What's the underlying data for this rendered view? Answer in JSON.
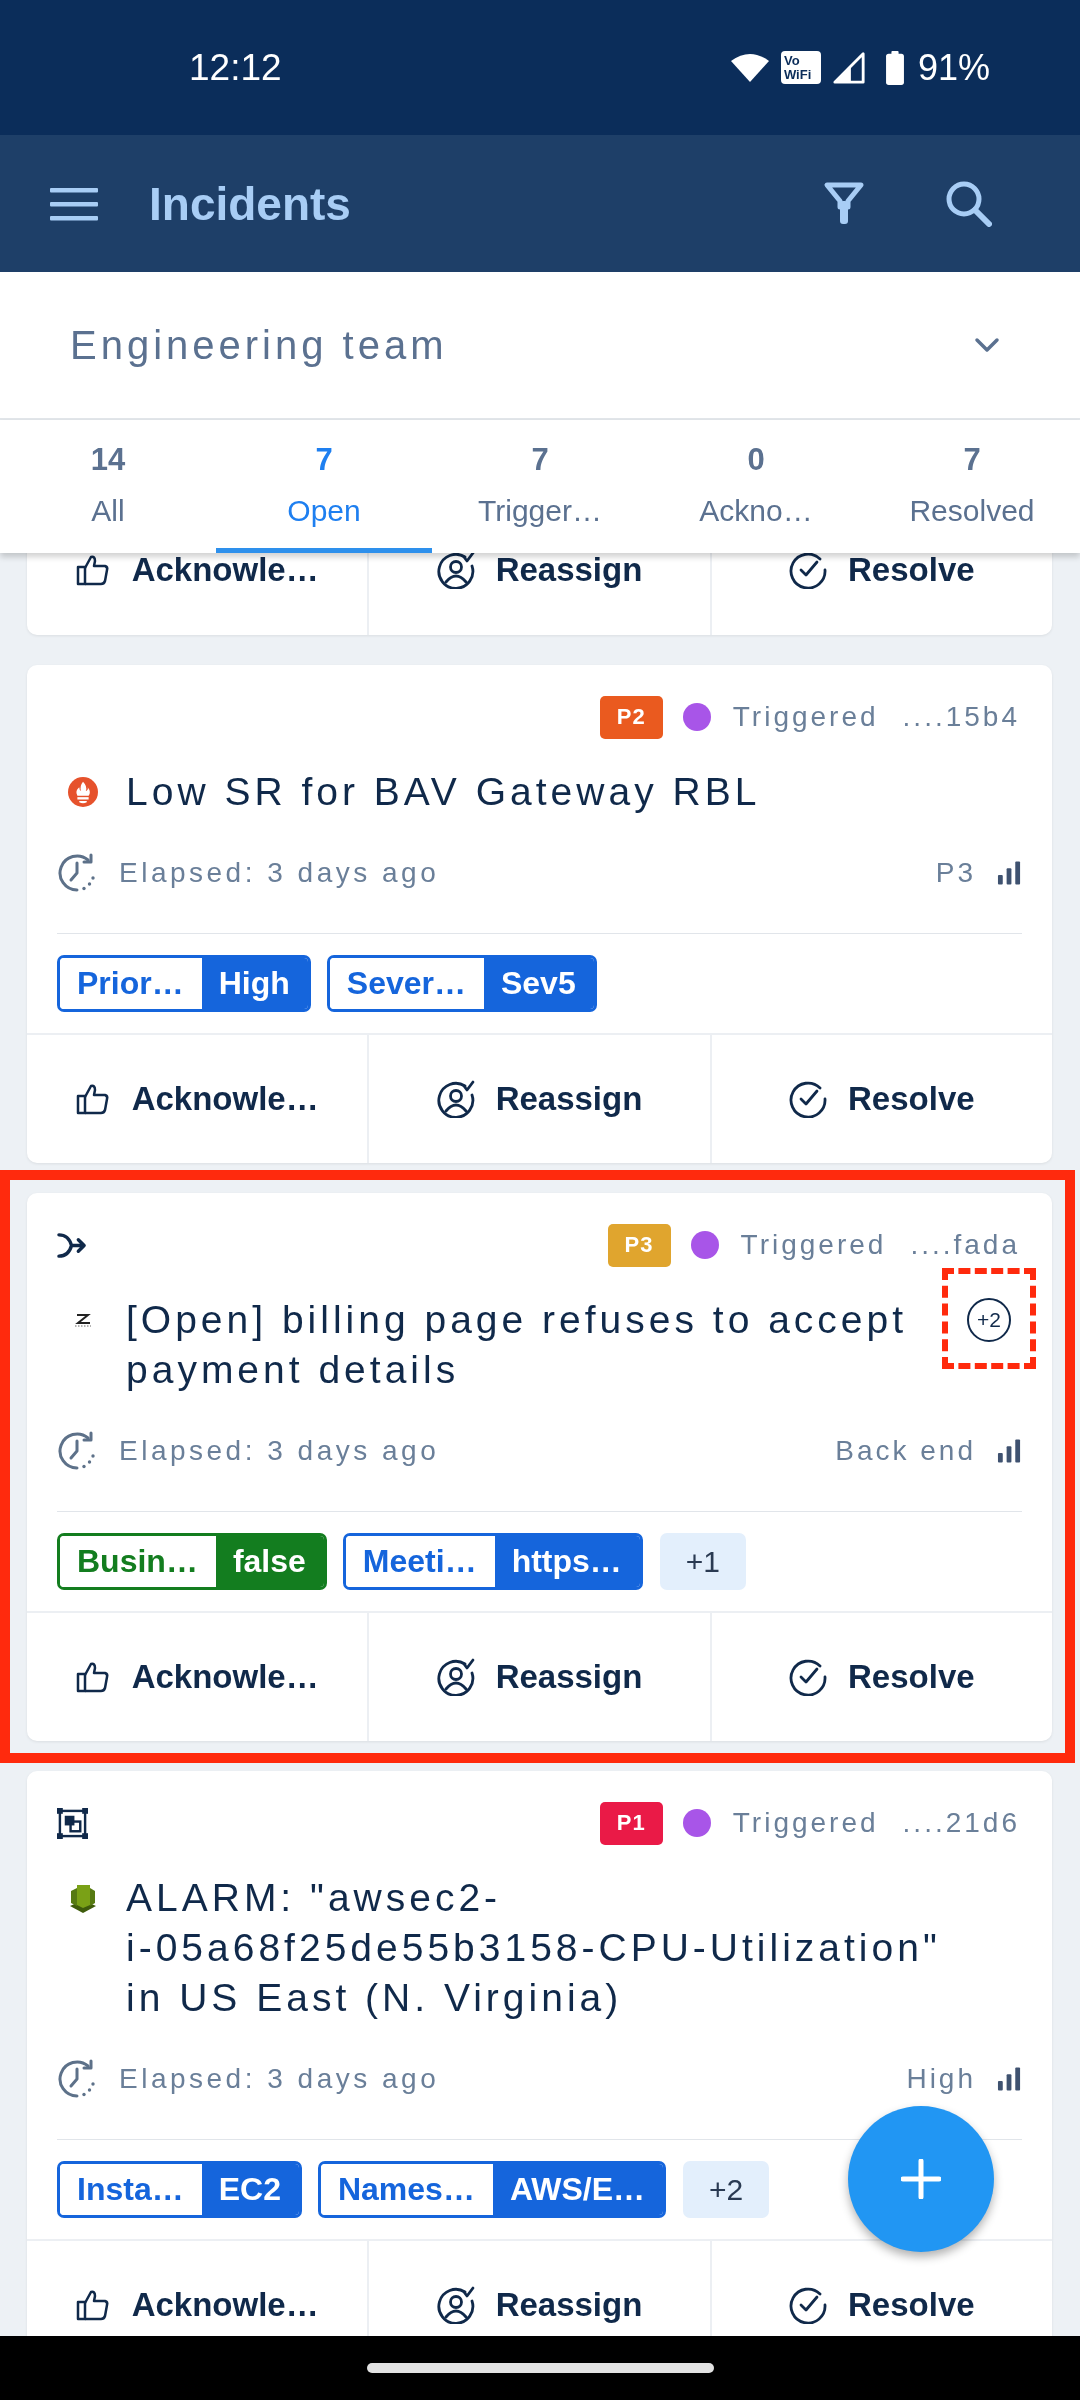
{
  "status_bar": {
    "time": "12:12",
    "vowifi_badge": [
      "Vo",
      "WiFi"
    ],
    "battery": "91%"
  },
  "app_bar": {
    "title": "Incidents"
  },
  "team_selector": {
    "value": "Engineering team"
  },
  "tabs": [
    {
      "count": "14",
      "label": "All",
      "selected": false
    },
    {
      "count": "7",
      "label": "Open",
      "selected": true
    },
    {
      "count": "7",
      "label": "Trigger…",
      "selected": false
    },
    {
      "count": "0",
      "label": "Ackno…",
      "selected": false
    },
    {
      "count": "7",
      "label": "Resolved",
      "selected": false
    }
  ],
  "incidents": [
    {
      "highlighted": false,
      "actions": [
        {
          "kind": "thumb",
          "label": "Acknowle…"
        },
        {
          "kind": "person",
          "label": "Reassign"
        },
        {
          "kind": "check",
          "label": "Resolve"
        }
      ]
    },
    {
      "highlighted": false,
      "priority": {
        "text": "P2",
        "color": "#ea5a1f"
      },
      "status": {
        "text": "Triggered",
        "color": "#a855e8"
      },
      "id": "....15b4",
      "title_icon": {
        "kind": "flame"
      },
      "title_lines": [
        "Low SR for BAV Gateway RBL"
      ],
      "elapsed": "Elapsed: 3 days ago",
      "right_label": "P3",
      "tags": [
        {
          "key": "Prior…",
          "value": "High",
          "color": "#1565dc"
        },
        {
          "key": "Sever…",
          "value": "Sev5",
          "color": "#1565dc"
        }
      ],
      "actions": [
        {
          "kind": "thumb",
          "label": "Acknowle…"
        },
        {
          "kind": "person",
          "label": "Reassign"
        },
        {
          "kind": "check",
          "label": "Resolve"
        }
      ]
    },
    {
      "highlighted": true,
      "header_icon": {
        "kind": "merge"
      },
      "priority": {
        "text": "P3",
        "color": "#e0a52e"
      },
      "status": {
        "text": "Triggered",
        "color": "#a855e8"
      },
      "id": "....fada",
      "title_icon": {
        "kind": "zigzag"
      },
      "title_lines": [
        "[Open] billing page refuses to accept",
        "payment details"
      ],
      "title_badge": {
        "text": "+2",
        "highlighted": true
      },
      "elapsed": "Elapsed: 3 days ago",
      "right_label": "Back end",
      "tags": [
        {
          "key": "Busin…",
          "value": "false",
          "color": "#137d1f"
        },
        {
          "key": "Meeti…",
          "value": "https…",
          "color": "#1565dc"
        }
      ],
      "more_tags": "+1",
      "actions": [
        {
          "kind": "thumb",
          "label": "Acknowle…"
        },
        {
          "kind": "person",
          "label": "Reassign"
        },
        {
          "kind": "check",
          "label": "Resolve"
        }
      ]
    },
    {
      "highlighted": false,
      "header_icon": {
        "kind": "frame"
      },
      "priority": {
        "text": "P1",
        "color": "#ea1a47"
      },
      "status": {
        "text": "Triggered",
        "color": "#a855e8"
      },
      "id": "....21d6",
      "title_icon": {
        "kind": "stack"
      },
      "title_lines": [
        "ALARM: \"awsec2-",
        "i-05a68f25de55b3158-CPU-Utilization\"",
        "in US East (N. Virginia)"
      ],
      "elapsed": "Elapsed: 3 days ago",
      "right_label": "High",
      "tags": [
        {
          "key": "Insta…",
          "value": "EC2",
          "color": "#1565dc"
        },
        {
          "key": "Names…",
          "value": "AWS/E…",
          "color": "#1565dc"
        }
      ],
      "more_tags": "+2",
      "actions": [
        {
          "kind": "thumb",
          "label": "Acknowle…"
        },
        {
          "kind": "person",
          "label": "Reassign"
        },
        {
          "kind": "check",
          "label": "Resolve"
        }
      ]
    }
  ]
}
